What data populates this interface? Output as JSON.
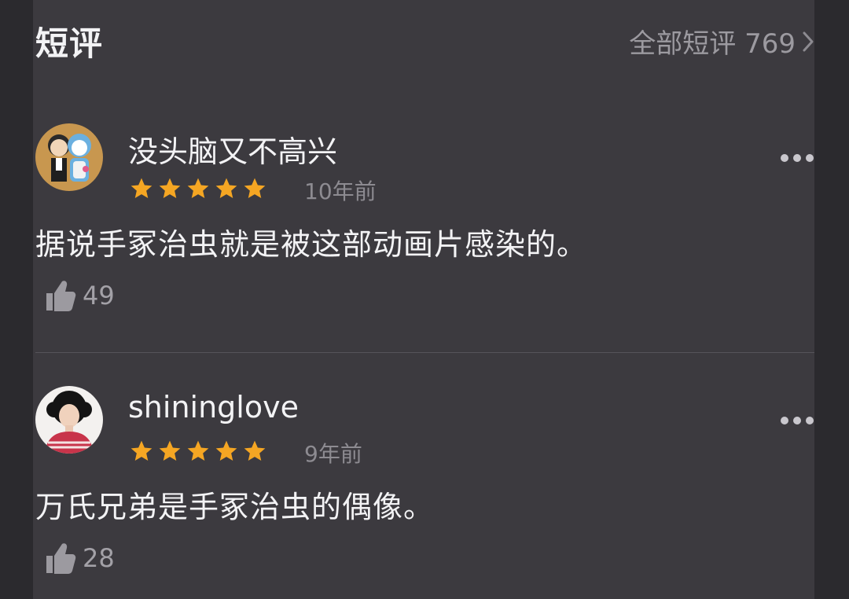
{
  "section": {
    "title": "短评",
    "all_link": "全部短评 769"
  },
  "comments": [
    {
      "username": "没头脑又不高兴",
      "rating": 5,
      "time": "10年前",
      "text": "据说手冢治虫就是被这部动画片感染的。",
      "likes": "49"
    },
    {
      "username": "shininglove",
      "rating": 5,
      "time": "9年前",
      "text": "万氏兄弟是手冢治虫的偶像。",
      "likes": "28"
    }
  ],
  "colors": {
    "background": "#2b2a2e",
    "card": "#3c3a3f",
    "star": "#f5a623",
    "text_primary": "#f3f3f5",
    "text_secondary": "#8d8b91"
  },
  "icons": {
    "chevron": "chevron-right-icon",
    "more": "more-horizontal-icon",
    "like": "thumbs-up-icon",
    "star": "star-icon"
  }
}
